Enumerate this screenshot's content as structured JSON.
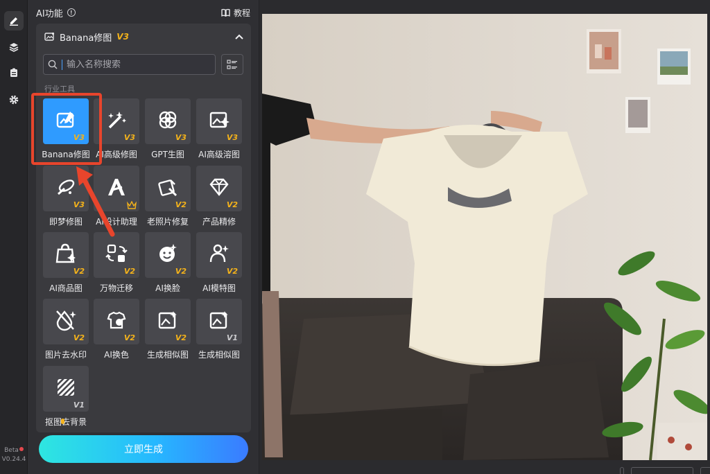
{
  "rail": {
    "beta": "Beta",
    "version": "V0.24.4"
  },
  "panel": {
    "title": "AI功能",
    "tutorial": "教程",
    "card_title": "Banana修图",
    "card_badge": "V3",
    "search_placeholder": "输入名称搜索",
    "section": "行业工具",
    "tools": [
      {
        "label": "Banana修图",
        "ver": "V3",
        "icon": "image-edit-icon",
        "selected": true
      },
      {
        "label": "AI高级修图",
        "ver": "V3",
        "icon": "magic-wand-icon"
      },
      {
        "label": "GPT生图",
        "ver": "V3",
        "icon": "gpt-knot-icon"
      },
      {
        "label": "AI高级溶图",
        "ver": "V3",
        "icon": "image-sparkle-icon"
      },
      {
        "label": "即梦修图",
        "ver": "V3",
        "icon": "dream-brush-icon"
      },
      {
        "label": "AI设计助理",
        "ver": "",
        "icon": "design-a-icon",
        "crown": true
      },
      {
        "label": "老照片修复",
        "ver": "V2",
        "icon": "photo-repair-icon"
      },
      {
        "label": "产品精修",
        "ver": "V2",
        "icon": "diamond-icon"
      },
      {
        "label": "AI商品图",
        "ver": "V2",
        "icon": "shopping-bag-icon"
      },
      {
        "label": "万物迁移",
        "ver": "V2",
        "icon": "transfer-icon"
      },
      {
        "label": "AI换脸",
        "ver": "V2",
        "icon": "face-swap-icon"
      },
      {
        "label": "AI模特图",
        "ver": "V2",
        "icon": "model-person-icon"
      },
      {
        "label": "图片去水印",
        "ver": "V2",
        "icon": "remove-watermark-icon"
      },
      {
        "label": "AI换色",
        "ver": "V2",
        "icon": "recolor-shirt-icon"
      },
      {
        "label": "生成相似图",
        "ver": "V2",
        "icon": "similar-image-icon"
      },
      {
        "label": "生成相似图",
        "ver": "V1",
        "ver_gray": true,
        "icon": "similar-image-icon"
      },
      {
        "label": "抠图去背景",
        "ver": "V1",
        "ver_gray": true,
        "icon": "cutout-icon"
      }
    ],
    "generate": "立即生成"
  },
  "colors": {
    "accent": "#2f9bff",
    "badge": "#f3b21b",
    "annotation": "#e8452c"
  }
}
